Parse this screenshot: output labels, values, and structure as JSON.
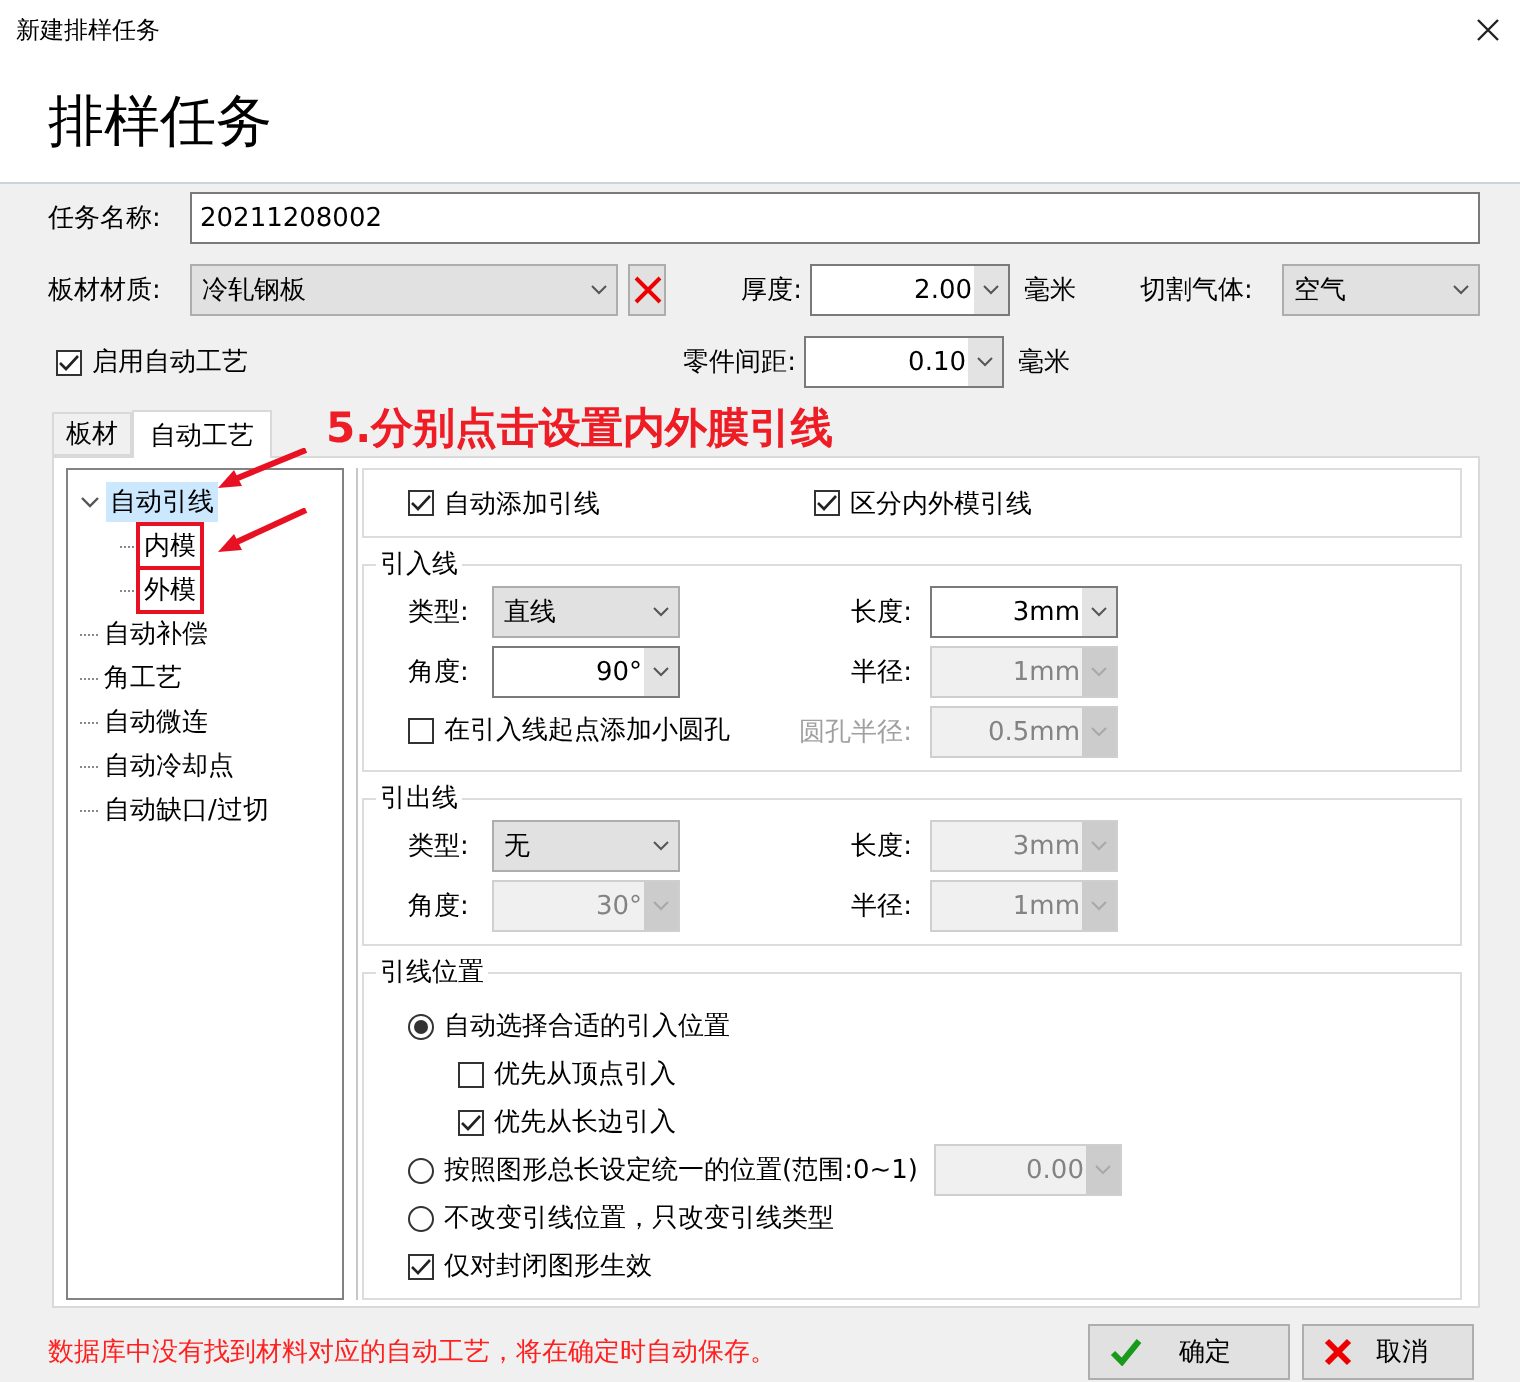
{
  "window": {
    "title": "新建排样任务"
  },
  "heading": "排样任务",
  "task_name": {
    "label": "任务名称:",
    "value": "20211208002"
  },
  "material": {
    "label": "板材材质:",
    "value": "冷轧钢板"
  },
  "thickness": {
    "label": "厚度:",
    "value": "2.00",
    "unit": "毫米"
  },
  "gas": {
    "label": "切割气体:",
    "value": "空气"
  },
  "enable_auto": {
    "label": "启用自动工艺",
    "checked": true
  },
  "spacing": {
    "label": "零件间距:",
    "value": "0.10",
    "unit": "毫米"
  },
  "tabs": [
    {
      "label": "板材",
      "selected": false
    },
    {
      "label": "自动工艺",
      "selected": true
    }
  ],
  "annotation": "5.分别点击设置内外膜引线",
  "tree": [
    {
      "label": "自动引线",
      "selected": true,
      "expanded": true,
      "children": [
        {
          "label": "内模",
          "selected": false,
          "marked": true
        },
        {
          "label": "外模",
          "selected": false,
          "marked": true
        }
      ]
    },
    {
      "label": "自动补偿",
      "selected": false
    },
    {
      "label": "角工艺",
      "selected": false
    },
    {
      "label": "自动微连",
      "selected": false
    },
    {
      "label": "自动冷却点",
      "selected": false
    },
    {
      "label": "自动缺口/过切",
      "selected": false
    }
  ],
  "options": [
    {
      "label": "自动添加引线",
      "checked": true
    },
    {
      "label": "区分内外模引线",
      "checked": true
    }
  ],
  "groups": [
    {
      "title": "引入线",
      "rows": [
        [
          {
            "kind": "combo",
            "label": "类型:",
            "label_disabled": false,
            "value": "直线",
            "disabled": false
          },
          {
            "kind": "spin",
            "label": "长度:",
            "label_disabled": false,
            "value": "3mm",
            "disabled": false
          }
        ],
        [
          {
            "kind": "spin",
            "label": "角度:",
            "label_disabled": false,
            "value": "90°",
            "disabled": false
          },
          {
            "kind": "spin",
            "label": "半径:",
            "label_disabled": false,
            "value": "1mm",
            "disabled": true
          }
        ],
        [
          {
            "kind": "checkbox",
            "label": "在引入线起点添加小圆孔",
            "checked": false
          },
          {
            "kind": "spin",
            "label": "圆孔半径:",
            "label_disabled": true,
            "value": "0.5mm",
            "disabled": true
          }
        ]
      ]
    },
    {
      "title": "引出线",
      "rows": [
        [
          {
            "kind": "combo",
            "label": "类型:",
            "label_disabled": false,
            "value": "无",
            "disabled": false
          },
          {
            "kind": "spin",
            "label": "长度:",
            "label_disabled": false,
            "value": "3mm",
            "disabled": true
          }
        ],
        [
          {
            "kind": "spin",
            "label": "角度:",
            "label_disabled": false,
            "value": "30°",
            "disabled": true
          },
          {
            "kind": "spin",
            "label": "半径:",
            "label_disabled": false,
            "value": "1mm",
            "disabled": true
          }
        ]
      ]
    }
  ],
  "position": {
    "title": "引线位置",
    "items": [
      {
        "kind": "radio",
        "label": "自动选择合适的引入位置",
        "selected": true,
        "children": [
          {
            "kind": "checkbox",
            "label": "优先从顶点引入",
            "checked": false
          },
          {
            "kind": "checkbox",
            "label": "优先从长边引入",
            "checked": true
          }
        ]
      },
      {
        "kind": "radio",
        "label": "按照图形总长设定统一的位置(范围:0~1)",
        "selected": false,
        "field": {
          "value": "0.00",
          "disabled": true
        }
      },
      {
        "kind": "radio",
        "label": "不改变引线位置，只改变引线类型",
        "selected": false
      },
      {
        "kind": "checkbox",
        "label": "仅对封闭图形生效",
        "checked": true
      }
    ]
  },
  "message": "数据库中没有找到材料对应的自动工艺，将在确定时自动保存。",
  "buttons": [
    {
      "kind": "ok",
      "label": "确定"
    },
    {
      "kind": "cancel",
      "label": "取消"
    }
  ]
}
